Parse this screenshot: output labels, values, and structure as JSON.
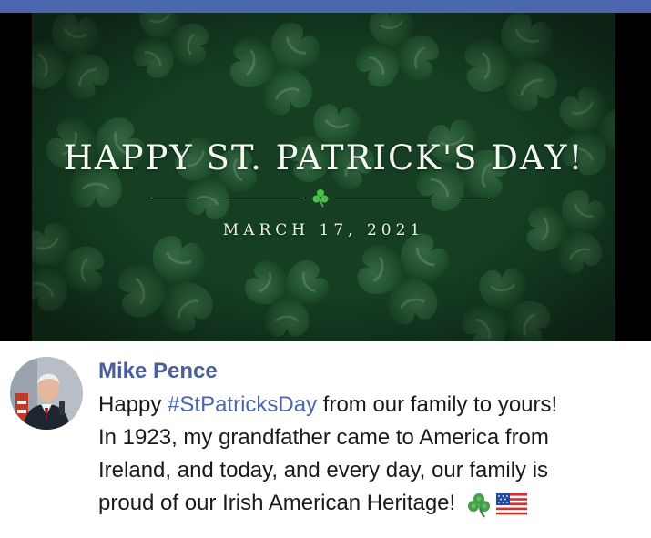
{
  "header_bar": {
    "color": "#4a67ad"
  },
  "graphic": {
    "headline": "HAPPY ST. PATRICK'S DAY!",
    "date": "MARCH 17, 2021",
    "divider_icon": "shamrock-icon",
    "background": "clover-field"
  },
  "post": {
    "author": "Mike Pence",
    "avatar": "profile-photo",
    "lines": {
      "l1_pre": "Happy ",
      "l1_hashtag": "#StPatricksDay",
      "l1_post": " from our family to yours!",
      "l2": "In 1923, my grandfather came to America from",
      "l3": "Ireland, and today, and every day, our family is",
      "l4": "proud of our Irish American Heritage!"
    },
    "emojis": [
      "shamrock-icon",
      "us-flag-icon"
    ]
  },
  "colors": {
    "author": "#4a5f9b",
    "hashtag": "#4a67ad",
    "text": "#1a1a1a",
    "clover_dark": "#1c4a2c",
    "clover_light": "#3d7a4b"
  }
}
